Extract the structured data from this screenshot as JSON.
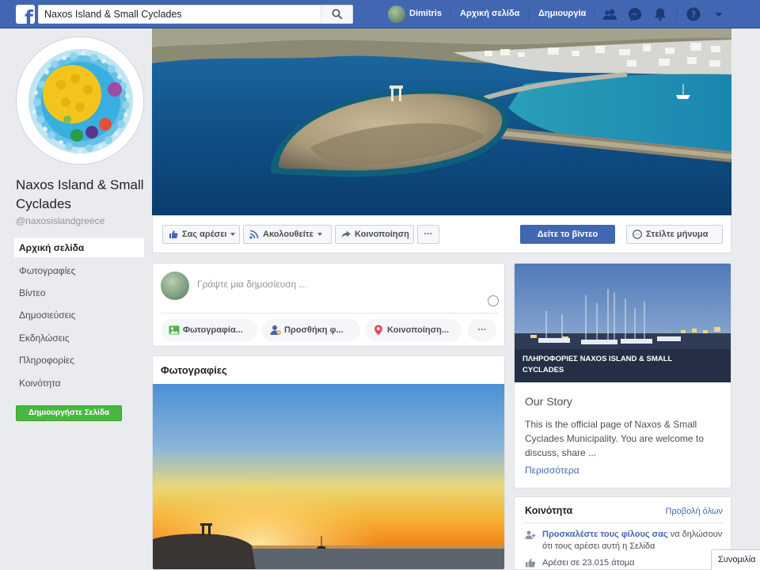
{
  "header": {
    "search_value": "Naxos Island & Small Cyclades",
    "user_name": "Dimitris",
    "home_label": "Αρχική σελίδα",
    "create_label": "Δημιουργία"
  },
  "colors": {
    "brand": "#4267b2",
    "create_green": "#4bb543",
    "link": "#4267b2"
  },
  "sidebar": {
    "page_name": "Naxos Island & Small Cyclades",
    "handle": "@naxosislandgreece",
    "nav": [
      {
        "label": "Αρχική σελίδα"
      },
      {
        "label": "Φωτογραφίες"
      },
      {
        "label": "Βίντεο"
      },
      {
        "label": "Δημοσιεύσεις"
      },
      {
        "label": "Εκδηλώσεις"
      },
      {
        "label": "Πληροφορίες"
      },
      {
        "label": "Κοινότητα"
      }
    ],
    "create_page_label": "Δημιουργήστε Σελίδα"
  },
  "actions": {
    "like_label": "Σας αρέσει",
    "follow_label": "Ακολουθείτε",
    "share_label": "Κοινοποίηση",
    "more_label": "···",
    "watch_label": "Δείτε το βίντεο",
    "message_label": "Στείλτε μήνυμα"
  },
  "composer": {
    "placeholder": "Γράψτε μια δημοσίευση ...",
    "actions": [
      {
        "label": "Φωτογραφία...",
        "icon": "photo-icon"
      },
      {
        "label": "Προσθήκη φ...",
        "icon": "tag-friends-icon"
      },
      {
        "label": "Κοινοποίηση...",
        "icon": "location-pin-icon"
      }
    ],
    "more_label": "···"
  },
  "photos": {
    "title": "Φωτογραφίες"
  },
  "our_story": {
    "caption": "ΠΛΗΡΟΦΟΡΙΕΣ NAXOS ISLAND & SMALL CYCLADES",
    "title": "Our Story",
    "body": "This is the official page of Naxos & Small Cyclades Municipality. You are welcome to discuss, share ...",
    "more_label": "Περισσότερα"
  },
  "community": {
    "title": "Κοινότητα",
    "see_all": "Προβολή όλων",
    "invite_link": "Προσκαλέστε τους φίλους σας",
    "invite_rest": "να δηλώσουν ότι τους αρέσει αυτή η Σελίδα",
    "likes_text": "Αρέσει σε 23.015 άτομα"
  },
  "chat": {
    "label": "Συνομιλία"
  }
}
